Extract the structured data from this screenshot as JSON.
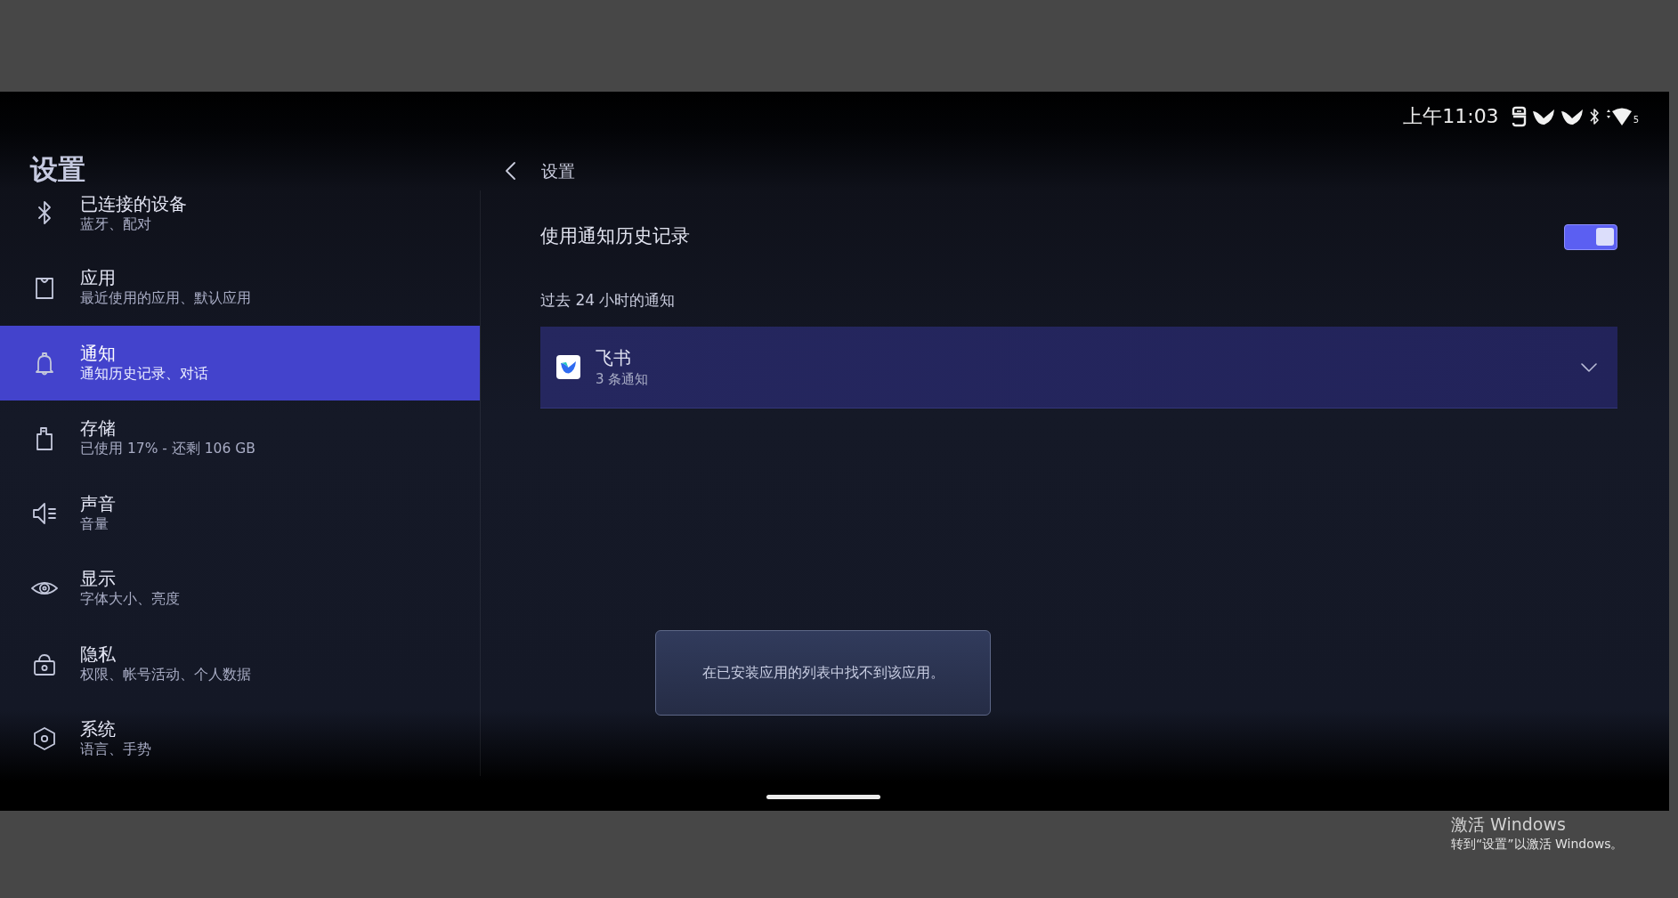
{
  "status_bar": {
    "time": "上午11:03",
    "wifi_badge": "5"
  },
  "sidebar": {
    "title": "设置",
    "items": [
      {
        "title": "已连接的设备",
        "subtitle": "蓝牙、配对",
        "selected": false
      },
      {
        "title": "应用",
        "subtitle": "最近使用的应用、默认应用",
        "selected": false
      },
      {
        "title": "通知",
        "subtitle": "通知历史记录、对话",
        "selected": true
      },
      {
        "title": "存储",
        "subtitle": "已使用 17% - 还剩 106 GB",
        "selected": false
      },
      {
        "title": "声音",
        "subtitle": "音量",
        "selected": false
      },
      {
        "title": "显示",
        "subtitle": "字体大小、亮度",
        "selected": false
      },
      {
        "title": "隐私",
        "subtitle": "权限、帐号活动、个人数据",
        "selected": false
      },
      {
        "title": "系统",
        "subtitle": "语言、手势",
        "selected": false
      }
    ]
  },
  "detail": {
    "header": "设置",
    "history_toggle": {
      "label": "使用通知历史记录",
      "on": true
    },
    "section_title": "过去 24 小时的通知",
    "apps": [
      {
        "name": "飞书",
        "count": "3 条通知",
        "expanded": false
      }
    ]
  },
  "toast": {
    "message": "在已安装应用的列表中找不到该应用。"
  },
  "activation_notice": {
    "title": "激活 Windows",
    "hint": "转到“设置”以激活 Windows。"
  }
}
